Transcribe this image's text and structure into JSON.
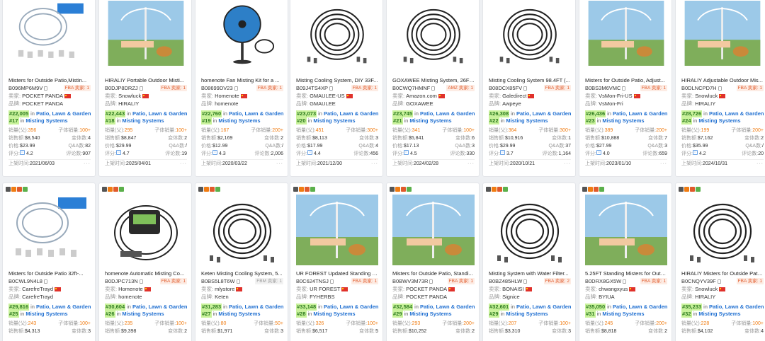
{
  "labels": {
    "seller": "卖家:",
    "brand": "品牌:",
    "in": "in",
    "sales_parent": "销量(父):",
    "sales_child": "子体销量:",
    "revenue": "销售额:",
    "variants": "变体数:",
    "price": "价格:",
    "qa": "Q&A数:",
    "rating": "评分:",
    "reviews": "评论数:",
    "listed": "上架时间:",
    "more": "···"
  },
  "row1": [
    {
      "title": "Misters for Outside Patio,Mistin...",
      "asin": "B096MP6M9V",
      "tag": "FBA 卖家: 1",
      "tag_type": "fba",
      "seller": "POCKET PANDA",
      "brand": "POCKET PANDA",
      "rank1": "#22,005",
      "cat1": "Patio, Lawn & Garden",
      "rank2": "#17",
      "cat2": "Misting Systems",
      "sales_parent": "356",
      "sales_child": "100+",
      "revenue": "$8,540",
      "variants": "4",
      "price": "$23.99",
      "qa": "82",
      "rating": "4.2",
      "reviews": "907",
      "listed": "2021/06/03",
      "img": "kit"
    },
    {
      "title": "HIRALIY Portable Outdoor Misti...",
      "asin": "B0DJP8DRZJ",
      "tag": "FBA 卖家: 1",
      "tag_type": "fba",
      "seller": "Snowluck",
      "brand": "HIRALIY",
      "rank1": "#22,443",
      "cat1": "Patio, Lawn & Garden",
      "rank2": "#18",
      "cat2": "Misting Systems",
      "sales_parent": "295",
      "sales_child": "100+",
      "revenue": "$8,847",
      "variants": "2",
      "price": "$29.99",
      "qa": "/",
      "rating": "4.7",
      "reviews": "19",
      "listed": "2025/04/01",
      "img": "photo"
    },
    {
      "title": "homenote Fan Misting Kit for a ...",
      "asin": "B08699DV23",
      "tag": "FBA 卖家: 1",
      "tag_type": "fba",
      "seller": "Homenote",
      "brand": "homenote",
      "rank1": "#22,760",
      "cat1": "Patio, Lawn & Garden",
      "rank2": "#19",
      "cat2": "Misting Systems",
      "sales_parent": "167",
      "sales_child": "200+",
      "revenue": "$2,169",
      "variants": "2",
      "price": "$12.99",
      "qa": "/",
      "rating": "4.3",
      "reviews": "2,006",
      "listed": "2020/03/22",
      "img": "fan"
    },
    {
      "title": "Misting Cooling System, DIY 33F...",
      "asin": "B09J4TS4XP",
      "tag": "FBA 卖家: 1",
      "tag_type": "fba",
      "seller": "GMAULEE-US",
      "brand": "GMAULEE",
      "rank1": "#23,073",
      "cat1": "Patio, Lawn & Garden",
      "rank2": "#20",
      "cat2": "Misting Systems",
      "sales_parent": "451",
      "sales_child": "300+",
      "revenue": "$8,113",
      "variants": "3",
      "price": "$17.99",
      "qa": "4",
      "rating": "4.4",
      "reviews": "456",
      "listed": "2021/12/30",
      "img": "hose"
    },
    {
      "title": "GOXAWEE Misting System, 26FT ...",
      "asin": "B0CWQ7HMNF",
      "tag": "AMZ 卖家: 1",
      "tag_type": "amz",
      "seller": "Amazon.com",
      "brand": "GOXAWEE",
      "rank1": "#23,745",
      "cat1": "Patio, Lawn & Garden",
      "rank2": "#21",
      "cat2": "Misting Systems",
      "sales_parent": "341",
      "sales_child": "100+",
      "revenue": "$5,841",
      "variants": "6",
      "price": "$17.13",
      "qa": "3",
      "rating": "4.5",
      "reviews": "330",
      "listed": "2024/02/28",
      "img": "hose"
    },
    {
      "title": "Misting Cooling System 98.4FT (...",
      "asin": "B08DCX85FV",
      "tag": "FBA 卖家: 1",
      "tag_type": "fba",
      "seller": "Galedirect",
      "brand": "Awpeye",
      "rank1": "#26,308",
      "cat1": "Patio, Lawn & Garden",
      "rank2": "#22",
      "cat2": "Misting Systems",
      "sales_parent": "364",
      "sales_child": "300+",
      "revenue": "$10,916",
      "variants": "1",
      "price": "$29.99",
      "qa": "37",
      "rating": "3.7",
      "reviews": "1,164",
      "listed": "2020/10/21",
      "img": "hose"
    },
    {
      "title": "Misters for Outside Patio, Adjust...",
      "asin": "B0BS3M6VMC",
      "tag": "FBA 卖家: 1",
      "tag_type": "fba",
      "seller": "VsMon-Fri-US",
      "brand": "VsMon-Fri",
      "rank1": "#26,436",
      "cat1": "Patio, Lawn & Garden",
      "rank2": "#23",
      "cat2": "Misting Systems",
      "sales_parent": "389",
      "sales_child": "200+",
      "revenue": "$10,888",
      "variants": "7",
      "price": "$27.99",
      "qa": "3",
      "rating": "4.0",
      "reviews": "659",
      "listed": "2023/01/10",
      "img": "photo"
    },
    {
      "title": "HIRALIY Adjustable Outdoor Mis...",
      "asin": "B0DLNCPD7H",
      "tag": "FBA 卖家: 1",
      "tag_type": "fba",
      "seller": "Snowluck",
      "brand": "HIRALIY",
      "rank1": "#28,726",
      "cat1": "Patio, Lawn & Garden",
      "rank2": "#24",
      "cat2": "Misting Systems",
      "sales_parent": "199",
      "sales_child": "200+",
      "revenue": "$7,162",
      "variants": "2",
      "price": "$35.99",
      "qa": "/",
      "rating": "4.2",
      "reviews": "20",
      "listed": "2024/10/31",
      "img": "photo"
    }
  ],
  "row2": [
    {
      "title": "Misters for Outside Patio 32ft-...",
      "asin": "B0CWL9N4L8",
      "tag": "",
      "tag_type": "none",
      "seller": "CarefreTrayd",
      "brand": "CarefreTrayd",
      "rank1": "#29,816",
      "cat1": "Patio, Lawn & Garden",
      "rank2": "#25",
      "cat2": "Misting Systems",
      "sales_parent": "243",
      "sales_child": "100+",
      "revenue": "$4,313",
      "variants": "3",
      "img": "kit"
    },
    {
      "title": "homenote Automatic Misting Co...",
      "asin": "B0DJPC713N",
      "tag": "FBA 卖家: 1",
      "tag_type": "fba",
      "seller": "Homenote",
      "brand": "homenote",
      "rank1": "#30,604",
      "cat1": "Patio, Lawn & Garden",
      "rank2": "#26",
      "cat2": "Misting Systems",
      "sales_parent": "235",
      "sales_child": "100+",
      "revenue": "$9,398",
      "variants": "2",
      "img": "timer"
    },
    {
      "title": "Keten Misting Cooling System, 5...",
      "asin": "B0BS5L8T6W",
      "tag": "FBM 卖家: 1",
      "tag_type": "fbm",
      "seller": "mlystore",
      "brand": "Keten",
      "rank1": "#31,283",
      "cat1": "Patio, Lawn & Garden",
      "rank2": "#27",
      "cat2": "Misting Systems",
      "sales_parent": "80",
      "sales_child": "50+",
      "revenue": "$1,971",
      "variants": "3",
      "img": "hose"
    },
    {
      "title": "UR FOREST Updated Standing M...",
      "asin": "B0C624TNSJ",
      "tag": "FBA 卖家: 1",
      "tag_type": "fba",
      "seller": "UR FOREST",
      "brand": "FYHERBS",
      "rank1": "#33,148",
      "cat1": "Patio, Lawn & Garden",
      "rank2": "#28",
      "cat2": "Misting Systems",
      "sales_parent": "326",
      "sales_child": "100+",
      "revenue": "$6,517",
      "variants": "5",
      "img": "photo"
    },
    {
      "title": "Misters for Outside Patio, Standi...",
      "asin": "B0BWV3M73R",
      "tag": "FBA 卖家: 1",
      "tag_type": "fba",
      "seller": "POCKET PANDA",
      "brand": "POCKET PANDA",
      "rank1": "#32,584",
      "cat1": "Patio, Lawn & Garden",
      "rank2": "#29",
      "cat2": "Misting Systems",
      "sales_parent": "293",
      "sales_child": "200+",
      "revenue": "$10,252",
      "variants": "2",
      "img": "photo"
    },
    {
      "title": "Misting System with Water Filter...",
      "asin": "B0BZ485HLW",
      "tag": "FBA 卖家: 2",
      "tag_type": "fba",
      "seller": "BONAISI",
      "brand": "Signice",
      "rank1": "#32,601",
      "cat1": "Patio, Lawn & Garden",
      "rank2": "#29",
      "cat2": "Misting Systems",
      "sales_parent": "207",
      "sales_child": "100+",
      "revenue": "$3,310",
      "variants": "3",
      "img": "hose"
    },
    {
      "title": "5.25FT Standing Misters for Outs...",
      "asin": "B0DRX8GX5W",
      "tag": "FBA 卖家: 1",
      "tag_type": "fba",
      "seller": "chwangxyus",
      "brand": "BYIUA",
      "rank1": "#35,050",
      "cat1": "Patio, Lawn & Garden",
      "rank2": "#31",
      "cat2": "Misting Systems",
      "sales_parent": "245",
      "sales_child": "200+",
      "revenue": "$8,818",
      "variants": "2",
      "img": "photo"
    },
    {
      "title": "HIRALIY Misters for Outside Patio...",
      "asin": "B0CNQYV39F",
      "tag": "FBA 卖家: 1",
      "tag_type": "fba",
      "seller": "Snowluck",
      "brand": "HIRALIY",
      "rank1": "#35,233",
      "cat1": "Patio, Lawn & Garden",
      "rank2": "#32",
      "cat2": "Misting Systems",
      "sales_parent": "228",
      "sales_child": "100+",
      "revenue": "$4,102",
      "variants": "4",
      "img": "hose"
    }
  ],
  "colors": {
    "rank_bg": "#c9f29b",
    "rank_text": "#2c7a1f",
    "category": "#1f6fd1",
    "sales_orange": "#f07c12",
    "fba_tag": "#e05a2b"
  }
}
